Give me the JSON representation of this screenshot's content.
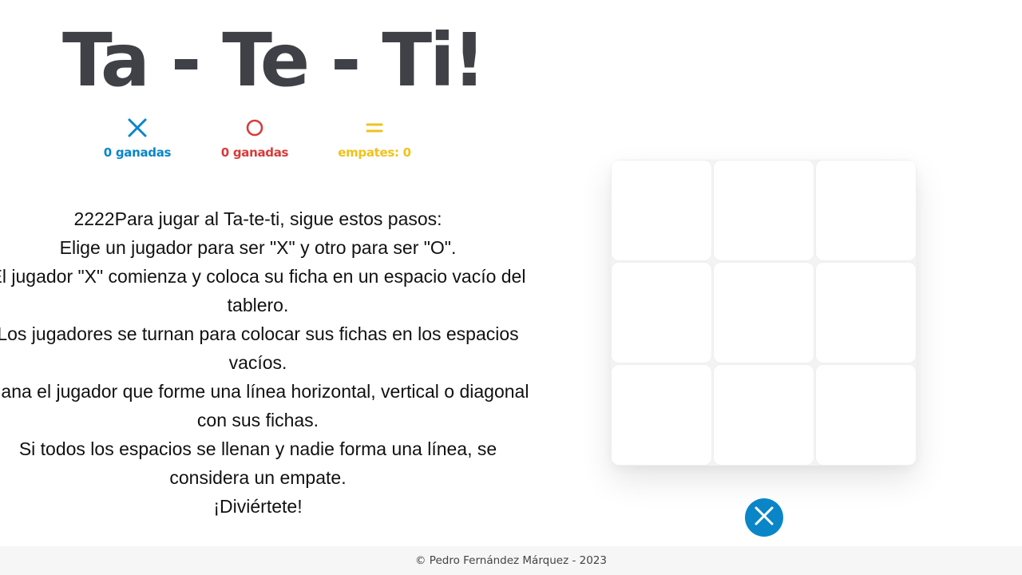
{
  "title": "Ta - Te - Ti!",
  "scoreboard": {
    "x": {
      "icon": "x-icon",
      "label": "0 ganadas",
      "color": "#0a86c8"
    },
    "o": {
      "icon": "circle-icon",
      "label": "0 ganadas",
      "color": "#d93a3a"
    },
    "draws": {
      "icon": "equals-icon",
      "label": "empates: 0",
      "color": "#f1c21b"
    }
  },
  "instructions": [
    "2222Para jugar al Ta-te-ti, sigue estos pasos:",
    "Elige un jugador para ser \"X\" y otro para ser \"O\".",
    "El jugador \"X\" comienza y coloca su ficha en un espacio vacío del tablero.",
    "Los jugadores se turnan para colocar sus fichas en los espacios vacíos.",
    "Gana el jugador que forme una línea horizontal, vertical o diagonal con sus fichas.",
    "Si todos los espacios se llenan y nadie forma una línea, se considera un empate.",
    "¡Diviértete!"
  ],
  "board": {
    "cells": [
      "",
      "",
      "",
      "",
      "",
      "",
      "",
      "",
      ""
    ]
  },
  "turn": {
    "player": "X",
    "icon": "x-icon",
    "color": "#0a86c8"
  },
  "footer": {
    "text": "© Pedro Fernández Márquez - 2023"
  }
}
